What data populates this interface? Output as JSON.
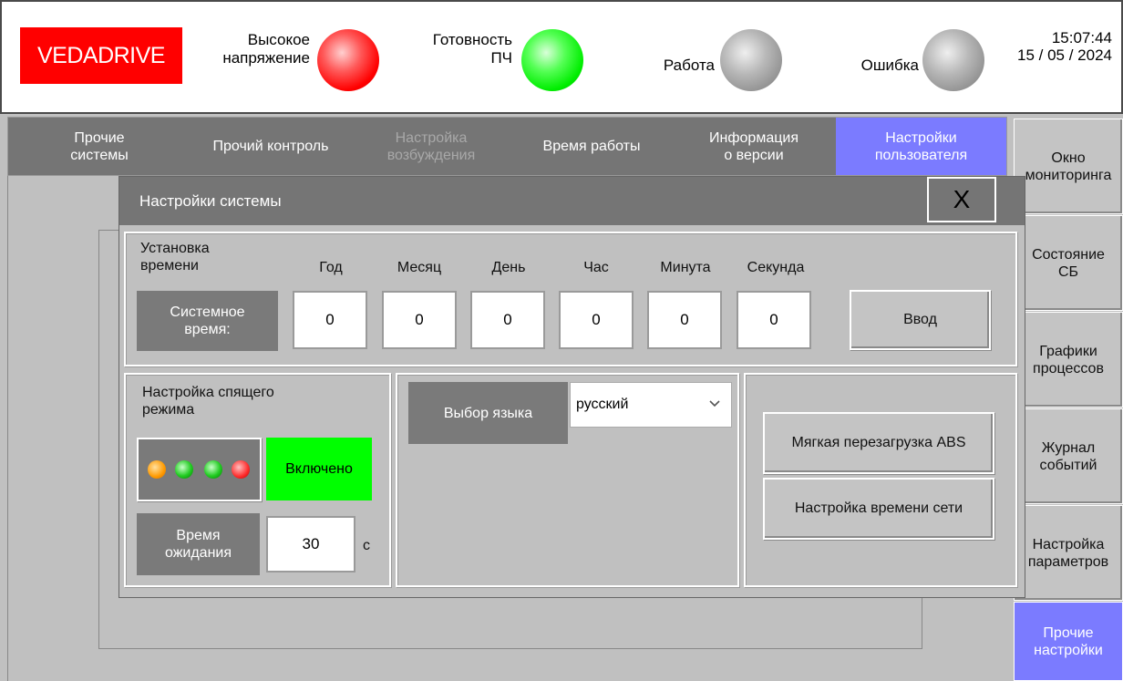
{
  "header": {
    "logo": "VEDADRIVE",
    "indicators": [
      {
        "label_line1": "Высокое",
        "label_line2": "напряжение",
        "state": "red"
      },
      {
        "label_line1": "Готовность",
        "label_line2": "ПЧ",
        "state": "green"
      },
      {
        "label_line1": "Работа",
        "label_line2": "",
        "state": "gray"
      },
      {
        "label_line1": "Ошибка",
        "label_line2": "",
        "state": "gray"
      }
    ],
    "time": "15:07:44",
    "date": "15 / 05 / 2024"
  },
  "tabs": [
    {
      "line1": "Прочие",
      "line2": "системы",
      "state": "normal"
    },
    {
      "line1": "Прочий контроль",
      "line2": "",
      "state": "normal"
    },
    {
      "line1": "Настройка",
      "line2": "возбуждения",
      "state": "disabled"
    },
    {
      "line1": "Время работы",
      "line2": "",
      "state": "normal"
    },
    {
      "line1": "Информация",
      "line2": "о версии",
      "state": "normal"
    },
    {
      "line1": "Настройки",
      "line2": "пользователя",
      "state": "active"
    }
  ],
  "nav": [
    {
      "line1": "Окно",
      "line2": "мониторинга"
    },
    {
      "line1": "Состояние",
      "line2": "СБ"
    },
    {
      "line1": "Графики",
      "line2": "процессов"
    },
    {
      "line1": "Журнал",
      "line2": "событий"
    },
    {
      "line1": "Настройка",
      "line2": "параметров"
    },
    {
      "line1": "Прочие",
      "line2": "настройки"
    }
  ],
  "dialog": {
    "title": "Настройки системы",
    "close_label": "X",
    "time_section": {
      "title_line1": "Установка",
      "title_line2": "времени",
      "columns": [
        "Год",
        "Месяц",
        "День",
        "Час",
        "Минута",
        "Секунда"
      ],
      "row_label_line1": "Системное",
      "row_label_line2": "время:",
      "values": [
        "0",
        "0",
        "0",
        "0",
        "0",
        "0"
      ],
      "enter_label": "Ввод"
    },
    "sleep_section": {
      "title_line1": "Настройка спящего",
      "title_line2": "режима",
      "status": "Включено",
      "status_color": "#00ff00",
      "wait_label_line1": "Время",
      "wait_label_line2": "ожидания",
      "wait_value": "30",
      "wait_unit": "с"
    },
    "language_section": {
      "label": "Выбор языка",
      "selected": "русский"
    },
    "actions": {
      "soft_reboot": "Мягкая перезагрузка ABS",
      "network_time": "Настройка времени сети"
    }
  }
}
